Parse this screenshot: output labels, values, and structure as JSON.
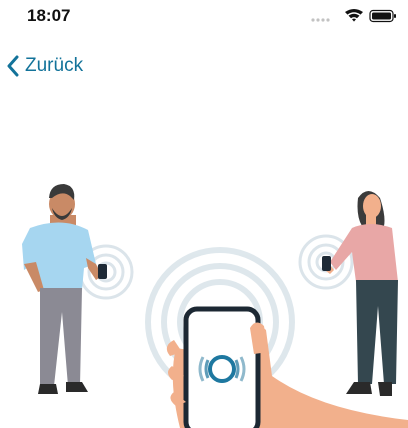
{
  "status_bar": {
    "time": "18:07",
    "icons": [
      "signal-icon",
      "wifi-icon",
      "battery-icon"
    ]
  },
  "nav": {
    "back_label": "Zurück",
    "back_icon": "chevron-left-icon"
  },
  "colors": {
    "accent": "#13739a",
    "shirt_man": "#9fd3ef",
    "shirt_woman": "#e9a8a6",
    "skin": "#f3b48a",
    "ring": "#d3dee4"
  }
}
